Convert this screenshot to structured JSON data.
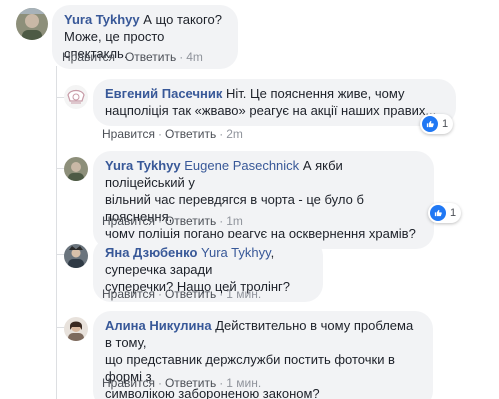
{
  "comments": [
    {
      "author": "Yura Tykhyy",
      "mention": "",
      "text": "А що такого?\nМоже, це просто спектакль.",
      "like": "Нравится",
      "reply": "Ответить",
      "time": "4m",
      "reactions": ""
    },
    {
      "author": "Евгений Пасечник",
      "mention": "",
      "text": "Ніт. Це пояснення живе, чому\nнацполіція так «жваво» реагує на акції наших правих...",
      "like": "Нравится",
      "reply": "Ответить",
      "time": "2m",
      "reactions": "1"
    },
    {
      "author": "Yura Tykhyy",
      "mention": "Eugene Pasechnick",
      "text": "А якби поліцейський у\nвільний час перевдягся в чорта - це було б пояснення,\nчому поліція погано реагує на осквернення храмів?",
      "like": "Нравится",
      "reply": "Ответить",
      "time": "1m",
      "reactions": "1"
    },
    {
      "author": "Яна Дзюбенко",
      "mention": "Yura Tykhyy",
      "text": ", суперечка заради\nсуперечки? Нащо цей тролінг?",
      "like": "Нравится",
      "reply": "Ответить",
      "time": "1 мин.",
      "reactions": ""
    },
    {
      "author": "Алина Никулина",
      "mention": "",
      "text": "Действительно в чому проблема в тому,\nщо представник держслужби постить фоточки в формі з\nсимволікою забороненою законом?",
      "like": "Нравится",
      "reply": "Ответить",
      "time": "1 мин.",
      "reactions": ""
    }
  ],
  "colors": {
    "author": "#385898",
    "bubble": "#f2f3f5",
    "meta": "#90949c",
    "like_blue": "#2078f4"
  },
  "icons": [
    "avatar",
    "like-icon"
  ]
}
